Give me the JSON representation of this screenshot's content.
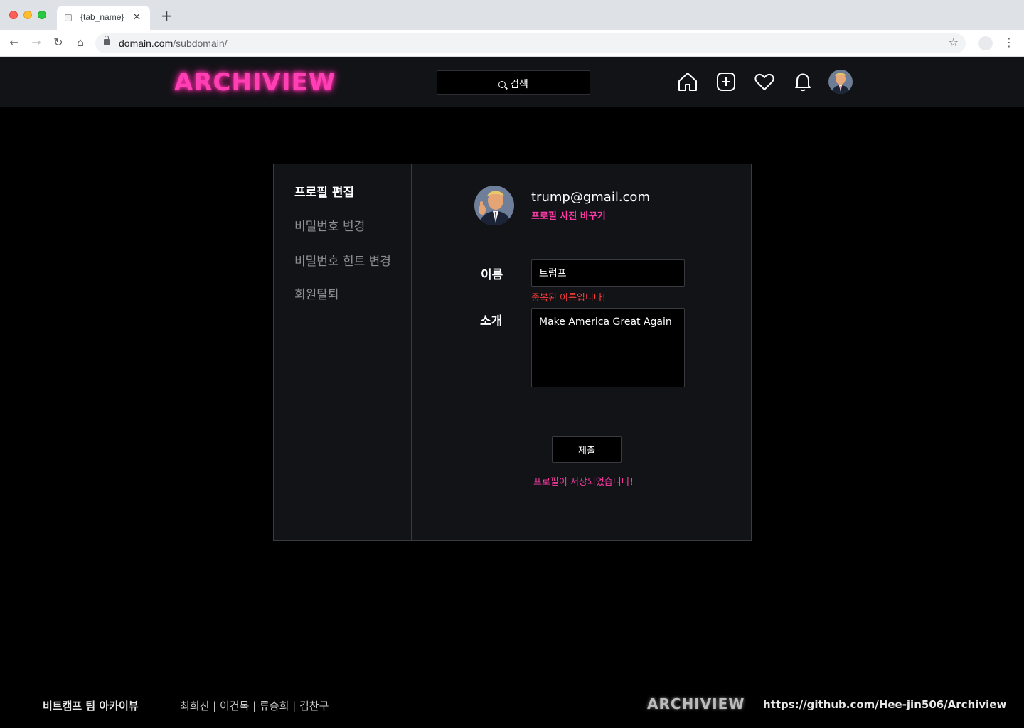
{
  "browser": {
    "tab_title": "{tab_name}",
    "tab_close": "×",
    "new_tab": "+",
    "url_domain": "domain.com",
    "url_path": "/subdomain/"
  },
  "header": {
    "logo": "ARCHIVIEW",
    "search_label": "검색",
    "icons": [
      "home-icon",
      "add-post-icon",
      "heart-icon",
      "bell-icon",
      "profile-avatar"
    ]
  },
  "sidebar": {
    "items": [
      {
        "label": "프로필 편집",
        "active": true
      },
      {
        "label": "비밀번호 변경",
        "active": false
      },
      {
        "label": "비밀번호 힌트 변경",
        "active": false
      },
      {
        "label": "회원탈퇴",
        "active": false
      }
    ]
  },
  "profile": {
    "email": "trump@gmail.com",
    "change_photo": "프로필 사진 바꾸기",
    "name_label": "이름",
    "name_value": "트럼프",
    "name_error": "중복된 이름입니다!",
    "bio_label": "소개",
    "bio_value": "Make America Great Again",
    "submit_label": "제출",
    "saved_message": "프로필이 저장되었습니다!"
  },
  "footer": {
    "team": "비트캠프 팀 아카이뷰",
    "members": "최희진 | 이건목 | 류승희 | 김찬구",
    "logo": "ARCHIVIEW",
    "repo_link": "https://github.com/Hee-jin506/Archiview"
  },
  "colors": {
    "accent": "#ff3aa6",
    "error": "#ff3b3b",
    "panel": "#121317"
  }
}
